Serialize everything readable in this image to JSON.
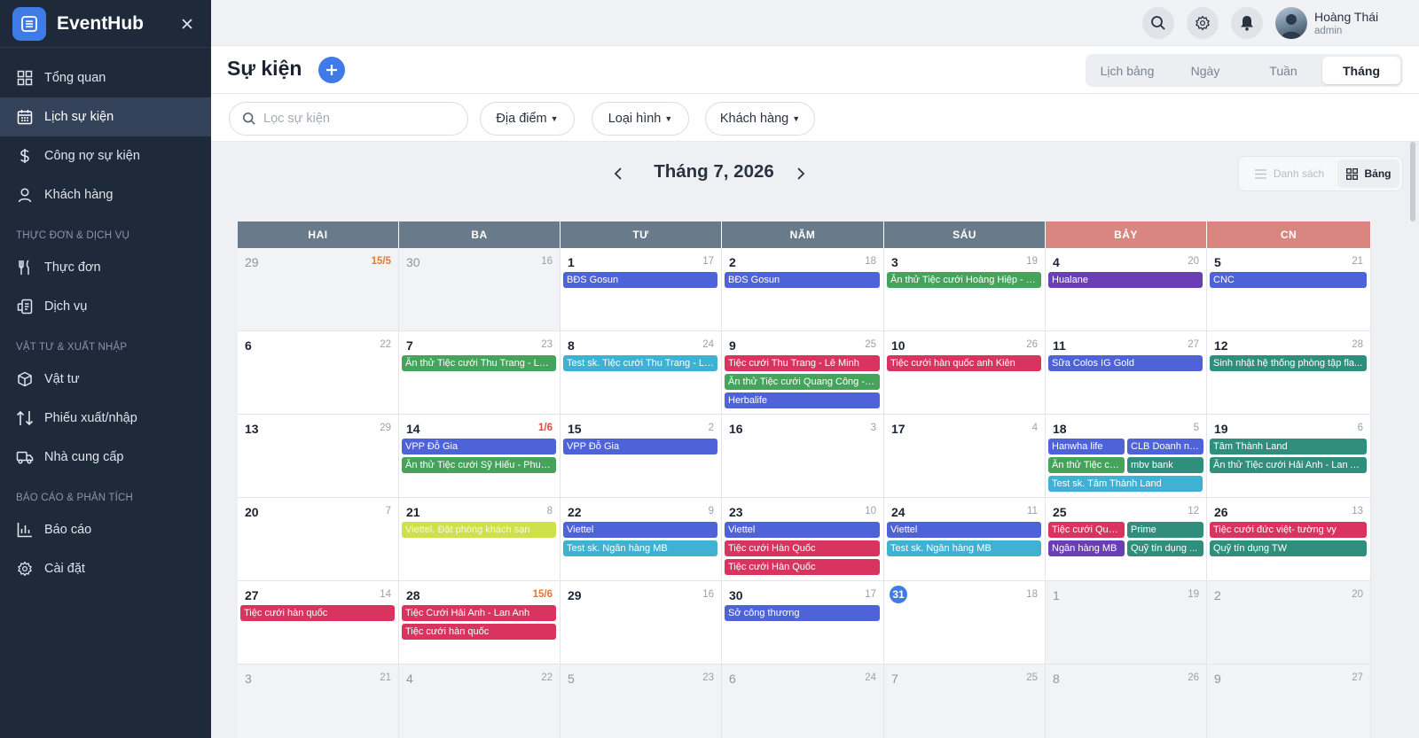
{
  "app": {
    "name": "EventHub"
  },
  "colors": {
    "sidebar_bg": "#1e2939",
    "accent": "#3f7be6",
    "weekday_header": "#697a8a",
    "weekend_header": "#d98580"
  },
  "sidebar": {
    "items": [
      {
        "label": "Tổng quan",
        "icon": "dashboard-icon",
        "active": false
      },
      {
        "label": "Lịch sự kiện",
        "icon": "calendar-icon",
        "active": true
      },
      {
        "label": "Công nợ sự kiện",
        "icon": "dollar-icon",
        "active": false
      },
      {
        "label": "Khách hàng",
        "icon": "user-icon",
        "active": false
      }
    ],
    "groups": [
      {
        "title": "THỰC ĐƠN & DỊCH VỤ",
        "items": [
          {
            "label": "Thực đơn",
            "icon": "utensils-icon"
          },
          {
            "label": "Dịch vụ",
            "icon": "service-icon"
          }
        ]
      },
      {
        "title": "VẬT TƯ & XUẤT NHẬP",
        "items": [
          {
            "label": "Vật tư",
            "icon": "box-icon"
          },
          {
            "label": "Phiếu xuất/nhập",
            "icon": "arrows-updown-icon"
          },
          {
            "label": "Nhà cung cấp",
            "icon": "truck-icon"
          }
        ]
      },
      {
        "title": "BÁO CÁO & PHÂN TÍCH",
        "items": [
          {
            "label": "Báo cáo",
            "icon": "bar-chart-icon"
          },
          {
            "label": "Cài đặt",
            "icon": "gear-icon"
          }
        ]
      }
    ]
  },
  "topbar": {
    "user_name": "Hoàng Thái",
    "user_role": "admin"
  },
  "header": {
    "title": "Sự kiện",
    "view_tabs": [
      {
        "label": "Lịch bảng",
        "active": false
      },
      {
        "label": "Ngày",
        "active": false
      },
      {
        "label": "Tuần",
        "active": false
      },
      {
        "label": "Tháng",
        "active": true
      }
    ]
  },
  "filters": {
    "search_placeholder": "Lọc sự kiện",
    "dropdowns": [
      "Địa điểm",
      "Loại hình",
      "Khách hàng"
    ]
  },
  "calendar": {
    "month_label": "Tháng 7, 2026",
    "modes": [
      {
        "label": "Danh sách",
        "active": false
      },
      {
        "label": "Bảng",
        "active": true
      }
    ],
    "weekdays": [
      "HAI",
      "BA",
      "TƯ",
      "NĂM",
      "SÁU",
      "BẢY",
      "CN"
    ],
    "weeks": [
      [
        {
          "day": "29",
          "lunar": "15/5",
          "lunar_style": "hl",
          "muted": true,
          "events": []
        },
        {
          "day": "30",
          "lunar": "16",
          "muted": true,
          "events": []
        },
        {
          "day": "1",
          "lunar": "17",
          "events": [
            {
              "title": "BĐS Gosun",
              "color": "#4f63d8"
            }
          ]
        },
        {
          "day": "2",
          "lunar": "18",
          "events": [
            {
              "title": "BĐS Gosun",
              "color": "#4f63d8"
            }
          ]
        },
        {
          "day": "3",
          "lunar": "19",
          "events": [
            {
              "title": "Ăn thử Tiệc cưới Hoàng Hiệp - T...",
              "color": "#46a35c"
            }
          ]
        },
        {
          "day": "4",
          "lunar": "20",
          "events": [
            {
              "title": "Hualane",
              "color": "#6a3fb5"
            }
          ]
        },
        {
          "day": "5",
          "lunar": "21",
          "events": [
            {
              "title": "CNC",
              "color": "#4f63d8"
            }
          ]
        }
      ],
      [
        {
          "day": "6",
          "lunar": "22",
          "events": []
        },
        {
          "day": "7",
          "lunar": "23",
          "events": [
            {
              "title": "Ăn thử Tiệc cưới Thu Trang - Lê ...",
              "color": "#46a35c"
            }
          ]
        },
        {
          "day": "8",
          "lunar": "24",
          "events": [
            {
              "title": "Test sk. Tiệc cưới Thu Trang - Lê...",
              "color": "#3fb2d4"
            }
          ]
        },
        {
          "day": "9",
          "lunar": "25",
          "events": [
            {
              "title": "Tiệc cưới Thu Trang - Lê Minh",
              "color": "#d8345f"
            },
            {
              "title": "Ăn thử Tiệc cưới Quang Công - T...",
              "color": "#46a35c"
            },
            {
              "title": "Herbalife",
              "color": "#4f63d8"
            }
          ]
        },
        {
          "day": "10",
          "lunar": "26",
          "events": [
            {
              "title": "Tiệc cưới hàn quốc anh Kiên",
              "color": "#d8345f"
            }
          ]
        },
        {
          "day": "11",
          "lunar": "27",
          "events": [
            {
              "title": "Sữa Colos IG Gold",
              "color": "#4f63d8"
            }
          ]
        },
        {
          "day": "12",
          "lunar": "28",
          "events": [
            {
              "title": "Sinh nhật hệ thống phòng tập fla...",
              "color": "#2f8f7c"
            }
          ]
        }
      ],
      [
        {
          "day": "13",
          "lunar": "29",
          "events": []
        },
        {
          "day": "14",
          "lunar": "1/6",
          "lunar_style": "red",
          "events": [
            {
              "title": "VPP Đỗ Gia",
              "color": "#4f63d8"
            },
            {
              "title": "Ăn thử Tiệc cưới Sỹ Hiếu - Phud...",
              "color": "#46a35c"
            }
          ]
        },
        {
          "day": "15",
          "lunar": "2",
          "events": [
            {
              "title": "VPP Đỗ Gia",
              "color": "#4f63d8"
            }
          ]
        },
        {
          "day": "16",
          "lunar": "3",
          "events": []
        },
        {
          "day": "17",
          "lunar": "4",
          "events": []
        },
        {
          "day": "18",
          "lunar": "5",
          "events": [
            {
              "title": "Hanwha life",
              "color": "#4f63d8"
            },
            {
              "title": "CLB Doanh nh...",
              "color": "#4f63d8"
            },
            {
              "title": "Ăn thử Tiệc cư...",
              "color": "#46a35c"
            },
            {
              "title": "mbv bank",
              "color": "#2f8f7c"
            },
            {
              "title": "Test sk. Tâm Thành Land",
              "color": "#3fb2d4",
              "wide": true
            }
          ]
        },
        {
          "day": "19",
          "lunar": "6",
          "events": [
            {
              "title": "Tâm Thành Land",
              "color": "#2f8f7c"
            },
            {
              "title": "Ăn thử Tiệc cưới Hải Anh - Lan A...",
              "color": "#2f8f7c"
            }
          ]
        }
      ],
      [
        {
          "day": "20",
          "lunar": "7",
          "events": []
        },
        {
          "day": "21",
          "lunar": "8",
          "events": [
            {
              "title": "Viettel. Đặt phòng khách sạn",
              "color": "#cfe04a"
            }
          ]
        },
        {
          "day": "22",
          "lunar": "9",
          "events": [
            {
              "title": "Viettel",
              "color": "#4f63d8"
            },
            {
              "title": "Test sk. Ngân hàng MB",
              "color": "#3fb2d4"
            }
          ]
        },
        {
          "day": "23",
          "lunar": "10",
          "events": [
            {
              "title": "Viettel",
              "color": "#4f63d8"
            },
            {
              "title": "Tiệc cưới Hàn Quốc",
              "color": "#d8345f"
            },
            {
              "title": "Tiệc cưới Hàn Quốc",
              "color": "#d8345f"
            }
          ]
        },
        {
          "day": "24",
          "lunar": "11",
          "events": [
            {
              "title": "Viettel",
              "color": "#4f63d8"
            },
            {
              "title": "Test sk. Ngân hàng MB",
              "color": "#3fb2d4"
            }
          ]
        },
        {
          "day": "25",
          "lunar": "12",
          "events": [
            {
              "title": "Tiệc cưới Qua...",
              "color": "#d8345f"
            },
            {
              "title": "Prime",
              "color": "#2f8f7c"
            },
            {
              "title": "Ngân hàng MB",
              "color": "#6a3fb5"
            },
            {
              "title": "Quỹ tín dụng ...",
              "color": "#2f8f7c"
            }
          ]
        },
        {
          "day": "26",
          "lunar": "13",
          "events": [
            {
              "title": "Tiệc cưới đức việt- tường vy",
              "color": "#d8345f"
            },
            {
              "title": "Quỹ tín dụng TW",
              "color": "#2f8f7c"
            }
          ]
        }
      ],
      [
        {
          "day": "27",
          "lunar": "14",
          "events": [
            {
              "title": "Tiệc cưới hàn quốc",
              "color": "#d8345f"
            }
          ]
        },
        {
          "day": "28",
          "lunar": "15/6",
          "lunar_style": "hl",
          "events": [
            {
              "title": "Tiệc Cưới Hải Anh - Lan Anh",
              "color": "#d8345f"
            },
            {
              "title": "Tiệc cưới hàn quốc",
              "color": "#d8345f"
            }
          ]
        },
        {
          "day": "29",
          "lunar": "16",
          "events": []
        },
        {
          "day": "30",
          "lunar": "17",
          "events": [
            {
              "title": "Sở công thương",
              "color": "#4f63d8"
            }
          ]
        },
        {
          "day": "31",
          "lunar": "18",
          "today": true,
          "events": []
        },
        {
          "day": "1",
          "lunar": "19",
          "muted": true,
          "events": []
        },
        {
          "day": "2",
          "lunar": "20",
          "muted": true,
          "events": []
        }
      ],
      [
        {
          "day": "3",
          "lunar": "21",
          "muted": true,
          "events": []
        },
        {
          "day": "4",
          "lunar": "22",
          "muted": true,
          "events": []
        },
        {
          "day": "5",
          "lunar": "23",
          "muted": true,
          "events": []
        },
        {
          "day": "6",
          "lunar": "24",
          "muted": true,
          "events": []
        },
        {
          "day": "7",
          "lunar": "25",
          "muted": true,
          "events": []
        },
        {
          "day": "8",
          "lunar": "26",
          "muted": true,
          "events": []
        },
        {
          "day": "9",
          "lunar": "27",
          "muted": true,
          "events": []
        }
      ]
    ]
  }
}
